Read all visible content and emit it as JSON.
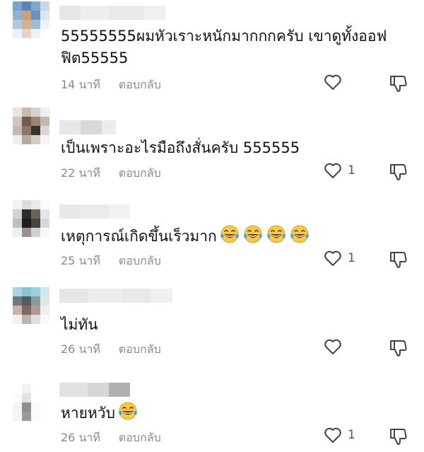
{
  "reply_label": "ตอบกลับ",
  "comments": [
    {
      "text": "55555555ผมหัวเราะหนักมากกกครับ เขาดูทั้งออฟฟิต55555",
      "time": "14 นาที",
      "likes": "",
      "emoji_count": 0,
      "emoji": "face-with-tears-of-joy"
    },
    {
      "text": "เป็นเพราะอะไรมือถึงสั่นครับ 555555",
      "time": "22 นาที",
      "likes": "1",
      "emoji_count": 0,
      "emoji": "face-with-tears-of-joy"
    },
    {
      "text": "เหตุการณ์เกิดขึ้นเร็วมาก",
      "time": "25 นาที",
      "likes": "1",
      "emoji_count": 4,
      "emoji": "face-with-tears-of-joy"
    },
    {
      "text": "ไม่ทัน",
      "time": "26 นาที",
      "likes": "",
      "emoji_count": 0,
      "emoji": "face-with-tears-of-joy"
    },
    {
      "text": "หายหวับ",
      "time": "26 นาที",
      "likes": "1",
      "emoji_count": 1,
      "emoji": "face-with-tears-of-joy"
    }
  ],
  "colors": {
    "meta": "#8a8a8a",
    "text": "#111111",
    "icon": "#444444",
    "emoji_face": "#f7c948",
    "emoji_tear": "#4aa3e0"
  }
}
